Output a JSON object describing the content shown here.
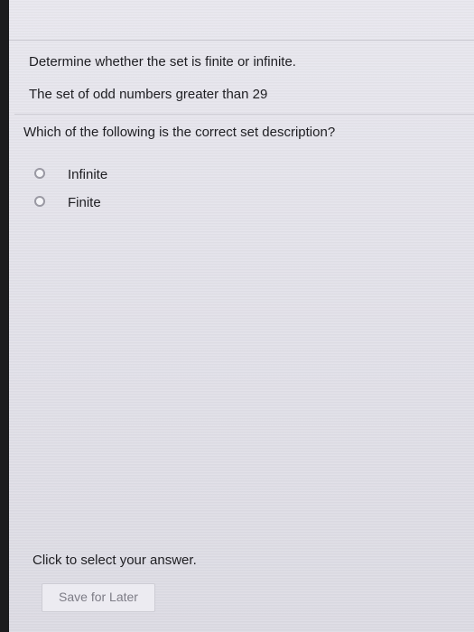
{
  "problem": {
    "instruction": "Determine whether the set is finite or infinite.",
    "set_description": "The set of odd numbers greater than 29"
  },
  "question": {
    "text": "Which of the following is the correct set description?",
    "options": [
      {
        "label": "Infinite",
        "selected": false
      },
      {
        "label": "Finite",
        "selected": false
      }
    ]
  },
  "footer": {
    "instruction": "Click to select your answer.",
    "save_label": "Save for Later"
  },
  "colors": {
    "screen_background": "#e6e5ec",
    "text": "#1e1e22",
    "radio_border": "#9a99a3",
    "button_text": "#7d7c86"
  }
}
